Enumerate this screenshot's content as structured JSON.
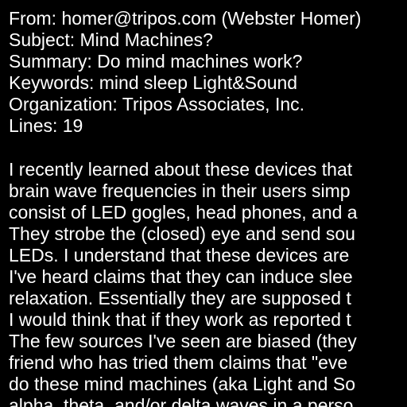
{
  "headers": [
    "From: homer@tripos.com (Webster Homer)",
    "Subject: Mind Machines?",
    "Summary: Do mind machines work?",
    "Keywords: mind sleep Light&Sound",
    "Organization: Tripos Associates, Inc.",
    "Lines: 19"
  ],
  "body_lines": [
    "I recently learned about these devices that",
    "brain wave frequencies in their users simp",
    "consist of LED gogles, head phones, and a",
    "They strobe the (closed) eye and send sou",
    "LEDs. I understand that these devices are",
    "I've heard claims that they can induce slee",
    "relaxation. Essentially they are supposed t",
    "I would think that if they work as reported t",
    "The few sources I've seen are biased (they",
    "friend who has tried them claims that \"eve",
    "do these mind machines (aka Light and So",
    "alpha, theta, and/or delta waves in a perso"
  ]
}
